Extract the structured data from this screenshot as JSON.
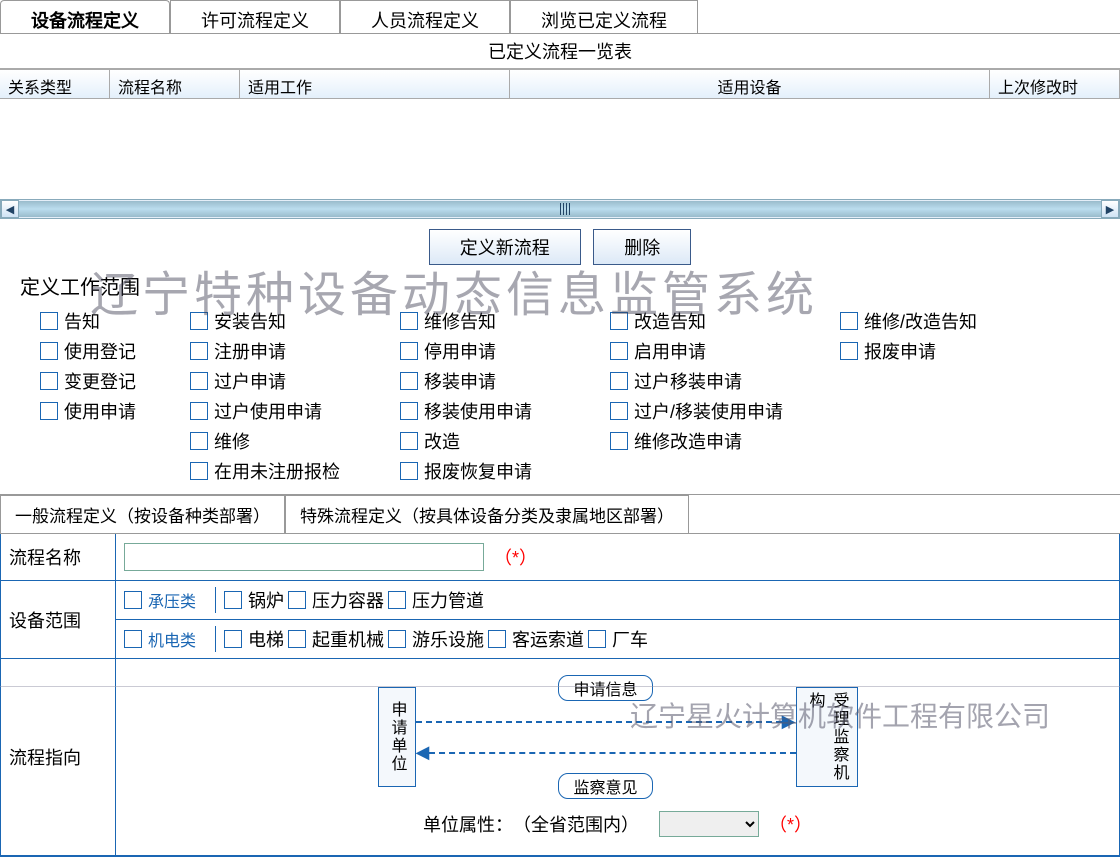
{
  "tabs": {
    "t1": "设备流程定义",
    "t2": "许可流程定义",
    "t3": "人员流程定义",
    "t4": "浏览已定义流程"
  },
  "list_title": "已定义流程一览表",
  "columns": {
    "c1": "关系类型",
    "c2": "流程名称",
    "c3": "适用工作",
    "c4": "适用设备",
    "c5": "上次修改时"
  },
  "buttons": {
    "new": "定义新流程",
    "del": "删除"
  },
  "scope_label": "定义工作范围",
  "scope": {
    "col1": {
      "a": "告知",
      "b": "使用登记",
      "c": "变更登记",
      "d": "使用申请"
    },
    "col2": {
      "a": "安装告知",
      "b": "注册申请",
      "c": "过户申请",
      "d": "过户使用申请",
      "e": "维修",
      "f": "在用未注册报检"
    },
    "col3": {
      "a": "维修告知",
      "b": "停用申请",
      "c": "移装申请",
      "d": "移装使用申请",
      "e": "改造",
      "f": "报废恢复申请"
    },
    "col4": {
      "a": "改造告知",
      "b": "启用申请",
      "c": "过户移装申请",
      "d": "过户/移装使用申请",
      "e": "维修改造申请"
    },
    "col5": {
      "a": "维修/改造告知",
      "b": "报废申请"
    }
  },
  "subtabs": {
    "s1": "一般流程定义（按设备种类部署）",
    "s2": "特殊流程定义（按具体设备分类及隶属地区部署）"
  },
  "form": {
    "name_label": "流程名称",
    "req": "（*）",
    "device_label": "设备范围",
    "cat1": "承压类",
    "cat1_opts": {
      "a": "锅炉",
      "b": "压力容器",
      "c": "压力管道"
    },
    "cat2": "机电类",
    "cat2_opts": {
      "a": "电梯",
      "b": "起重机械",
      "c": "游乐设施",
      "d": "客运索道",
      "e": "厂车"
    },
    "flow_label": "流程指向",
    "box1": "申请单位",
    "badge1": "申请信息",
    "badge2": "监察意见",
    "box2": "受理监察机构",
    "unit_label": "单位属性：",
    "unit_scope": "（全省范围内）"
  },
  "watermarks": {
    "w1": "辽宁特种设备动态信息监管系统",
    "w2": "辽宁星火计算机软件工程有限公司"
  }
}
